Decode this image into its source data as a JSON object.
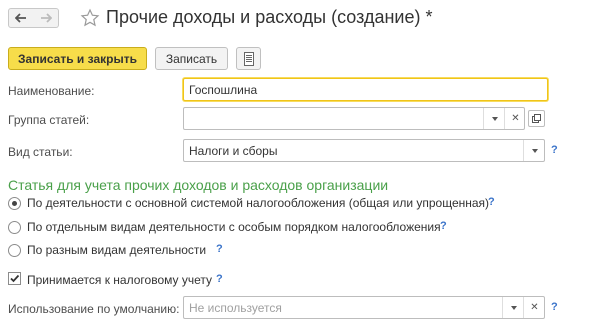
{
  "header": {
    "title": "Прочие доходы и расходы (создание) *"
  },
  "toolbar": {
    "save_close_label": "Записать и закрыть",
    "save_label": "Записать"
  },
  "form": {
    "name_label": "Наименование:",
    "name_value": "Госпошлина",
    "group_label": "Группа статей:",
    "group_value": "",
    "type_label": "Вид статьи:",
    "type_value": "Налоги и сборы",
    "help_mark": "?"
  },
  "section": {
    "title": "Статья для учета прочих доходов и расходов организации",
    "options": [
      {
        "label": "По деятельности с основной системой налогообложения (общая или упрощенная)",
        "selected": true
      },
      {
        "label": "По отдельным видам деятельности с особым порядком налогообложения",
        "selected": false
      },
      {
        "label": "По разным видам деятельности",
        "selected": false
      }
    ],
    "tax_checkbox_label": "Принимается к налоговому учету",
    "tax_checkbox_checked": true,
    "default_usage_label": "Использование по умолчанию:",
    "default_usage_placeholder": "Не используется"
  },
  "colors": {
    "accent": "#f7dd4a",
    "section_green": "#4aa04a",
    "help_blue": "#3a73c9"
  },
  "icons": {
    "back": "arrow-left-icon",
    "forward": "arrow-right-icon",
    "favorite": "star-icon",
    "document": "document-icon",
    "dropdown": "chevron-down-icon",
    "clear": "clear-icon",
    "open": "open-icon",
    "check": "checkmark-icon"
  }
}
